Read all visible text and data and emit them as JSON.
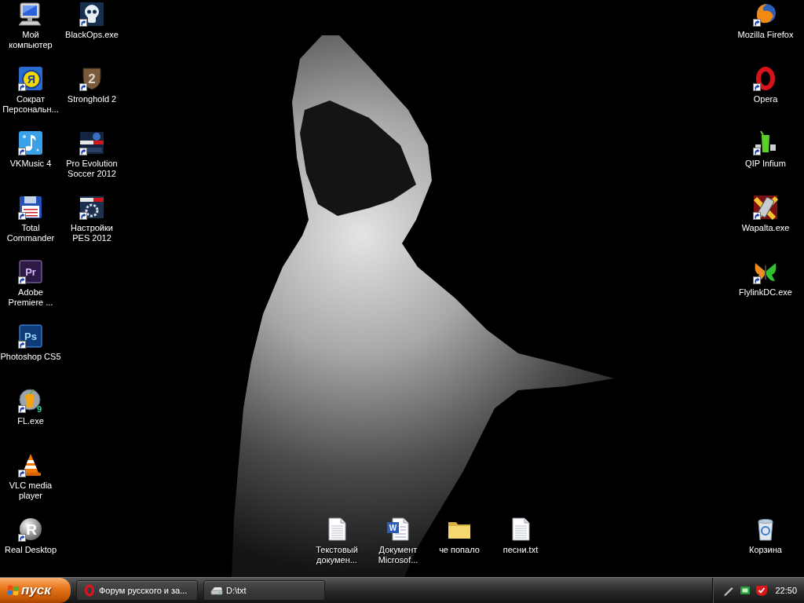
{
  "desktop": {
    "left_column": [
      {
        "kind": "computer",
        "label": "Мой\nкомпьютер",
        "shortcut": false
      },
      {
        "kind": "socrat",
        "label": "Сократ\nПерсональн...",
        "shortcut": true,
        "logo_text": "Я"
      },
      {
        "kind": "music",
        "label": "VKMusic 4",
        "shortcut": true
      },
      {
        "kind": "floppy",
        "label": "Total\nCommander",
        "shortcut": true
      },
      {
        "kind": "premiere",
        "label": "Adobe\nPremiere ...",
        "shortcut": true,
        "logo_text": "Pr"
      },
      {
        "kind": "photoshop",
        "label": "Photoshop CS5",
        "shortcut": true,
        "logo_text": "Ps"
      },
      {
        "kind": "fruit",
        "label": "FL.exe",
        "shortcut": true,
        "logo_text": "9"
      },
      {
        "kind": "cone",
        "label": "VLC media\nplayer",
        "shortcut": true
      },
      {
        "kind": "sphere",
        "label": "Real Desktop",
        "shortcut": true,
        "logo_text": "R"
      }
    ],
    "second_column": [
      {
        "kind": "skull",
        "label": "BlackOps.exe",
        "shortcut": true
      },
      {
        "kind": "shield",
        "label": "Stronghold 2",
        "shortcut": true,
        "logo_text": "2"
      },
      {
        "kind": "soccer",
        "label": "Pro Evolution\nSoccer 2012",
        "shortcut": true
      },
      {
        "kind": "soccersettings",
        "label": "Настройки\nPES 2012",
        "shortcut": true
      }
    ],
    "right_column": [
      {
        "kind": "firefox",
        "label": "Mozilla Firefox",
        "shortcut": true
      },
      {
        "kind": "opera",
        "label": "Opera",
        "shortcut": true
      },
      {
        "kind": "qip",
        "label": "QIP Infium",
        "shortcut": true
      },
      {
        "kind": "phone",
        "label": "Wapalta.exe",
        "shortcut": true
      },
      {
        "kind": "butterfly",
        "label": "FlylinkDC.exe",
        "shortcut": true
      }
    ],
    "bottom_row": [
      {
        "kind": "textdoc",
        "label": "Текстовый\nдокумен...",
        "shortcut": false
      },
      {
        "kind": "worddoc",
        "label": "Документ\nMicrosof...",
        "shortcut": false,
        "logo_text": "W"
      },
      {
        "kind": "folder",
        "label": "че попало",
        "shortcut": false
      },
      {
        "kind": "textdoc",
        "label": "песни.txt",
        "shortcut": false
      }
    ],
    "recycle_bin": {
      "kind": "bin",
      "label": "Корзина",
      "shortcut": false
    }
  },
  "taskbar": {
    "start_label": "пуск",
    "tasks": [
      {
        "kind": "ring",
        "label": "Форум русского и за..."
      },
      {
        "kind": "drive",
        "label": "D:\\txt"
      }
    ],
    "clock": "22:50"
  }
}
